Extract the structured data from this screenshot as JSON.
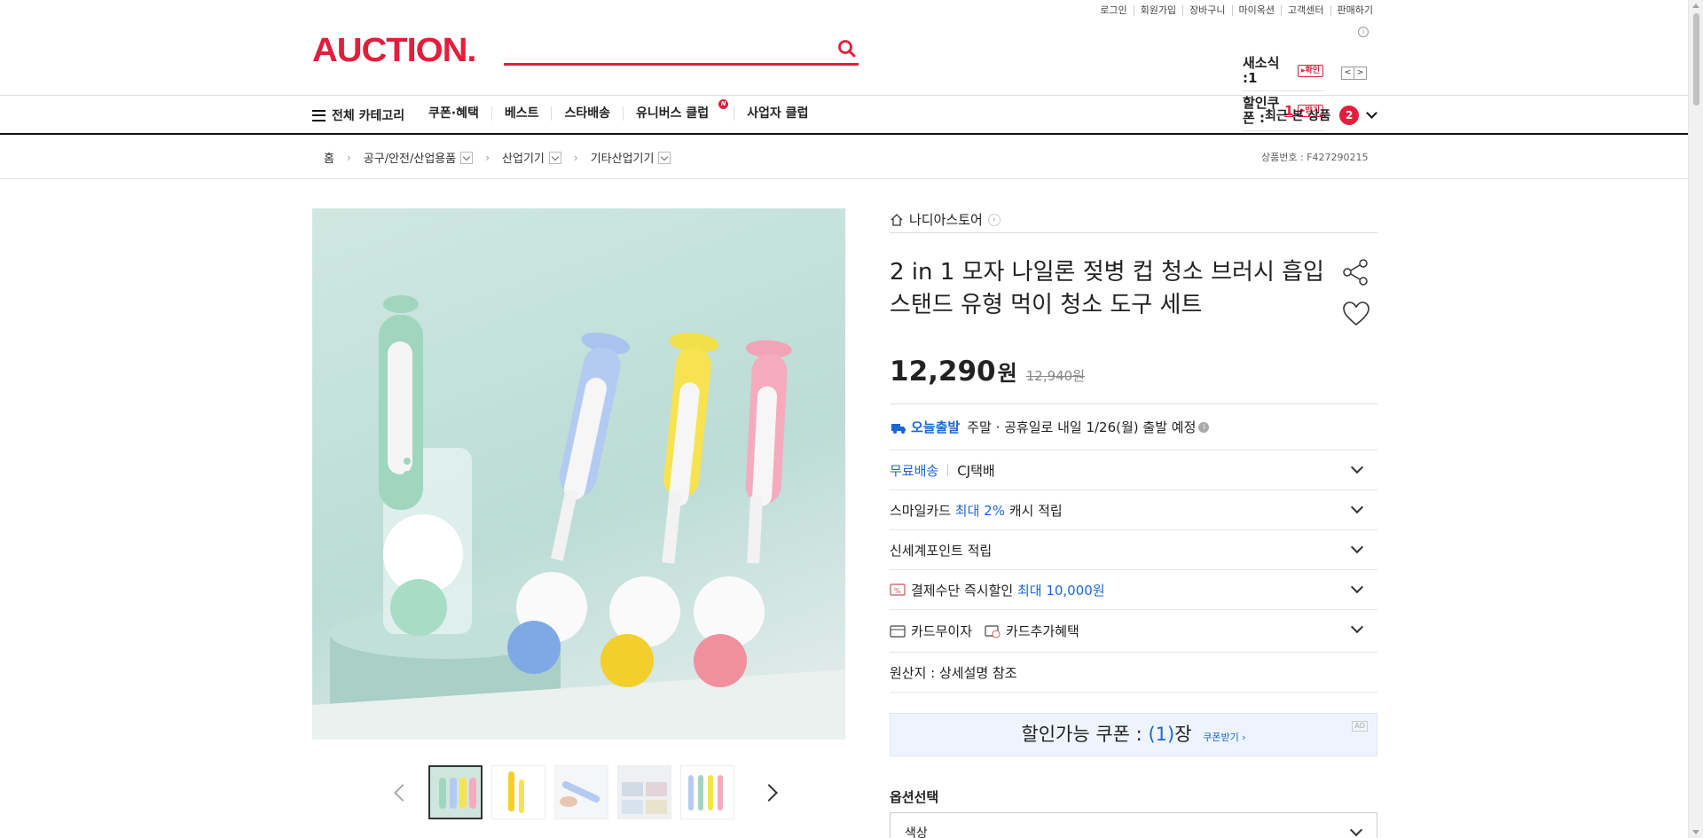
{
  "header": {
    "util_links": [
      "로그인",
      "회원가입",
      "장바구니",
      "마이옥션",
      "고객센터",
      "판매하기"
    ],
    "logo": "AUCTION.",
    "search_placeholder": "",
    "mini": {
      "newsletter_label": "새소식 :",
      "newsletter_count": "1",
      "newsletter_action": "확인",
      "coupon_label": "할인쿠폰 :",
      "coupon_count": "1",
      "coupon_action": "받기"
    }
  },
  "nav": {
    "all_category": "전체 카테고리",
    "items": [
      "쿠폰·혜택",
      "베스트",
      "스타배송",
      "유니버스 클럽",
      "사업자 클럽"
    ],
    "universe_badge": "N",
    "recent_label": "최근 본 상품",
    "recent_count": "2"
  },
  "breadcrumb": {
    "home": "홈",
    "levels": [
      "공구/안전/산업용품",
      "산업기기",
      "기타산업기기"
    ],
    "product_no": "상품번호 : F427290215"
  },
  "product": {
    "store": "나디아스토어",
    "title": "2 in 1 모자 나일론 젖병 컵 청소 브러시 흡입 스탠드 유형 먹이 청소 도구 세트",
    "price": "12,290",
    "won": "원",
    "original_price": "12,940원",
    "rows": {
      "today_ship_label": "오늘출발",
      "today_ship_text": "주말 · 공휴일로 내일 1/26(월) 출발 예정",
      "free_ship": "무료배송",
      "courier": "CJ택배",
      "smile_card": "스마일카드",
      "smile_max": "최대 2%",
      "smile_cash": "캐시 적립",
      "ssg_point": "신세계포인트 적립",
      "pay_discount": "결제수단 즉시할인",
      "pay_max": "최대 10,000원",
      "card_no_interest": "카드무이자",
      "card_extra": "카드추가혜택",
      "origin": "원산지 : 상세설명 참조"
    },
    "coupon_text_a": "할인가능 쿠폰 : ",
    "coupon_count": "(1)",
    "coupon_text_b": "장",
    "coupon_get": "쿠폰받기 ›",
    "coupon_ad": "AD",
    "option_title": "옵션선택",
    "option_color": "색상"
  },
  "colors": {
    "brand": "#e31e3c",
    "link_blue": "#1a67d2"
  }
}
